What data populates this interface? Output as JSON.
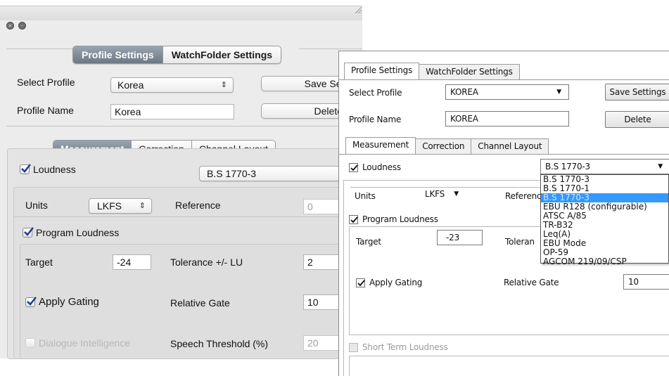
{
  "mac_window": {
    "tabs": [
      "Profile Settings",
      "WatchFolder Settings"
    ],
    "select_profile_label": "Select Profile",
    "select_profile_value": "Korea",
    "save_button": "Save Setting",
    "profile_name_label": "Profile Name",
    "profile_name_value": "Korea",
    "delete_button": "Delete",
    "sub_tabs": [
      "Measurement",
      "Correction",
      "Channel Layout"
    ],
    "loudness_label": "Loudness",
    "loudness_standard": "B.S 1770-3",
    "units_label": "Units",
    "units_value": "LKFS",
    "reference_label": "Reference",
    "reference_value": "0",
    "program_loudness_label": "Program Loudness",
    "target_label": "Target",
    "target_value": "-24",
    "tolerance_label": "Tolerance +/- LU",
    "tolerance_value": "2",
    "apply_gating_label": "Apply Gating",
    "relative_gate_label": "Relative Gate",
    "relative_gate_value": "10",
    "dialogue_label": "Dialogue Intelligence",
    "speech_threshold_label": "Speech Threshold (%)",
    "speech_threshold_value": "20"
  },
  "win_window": {
    "tabs": [
      "Profile Settings",
      "WatchFolder Settings"
    ],
    "select_profile_label": "Select Profile",
    "select_profile_value": "KOREA",
    "save_button": "Save Settings",
    "profile_name_label": "Profile Name",
    "profile_name_value": "KOREA",
    "delete_button": "Delete",
    "sub_tabs": [
      "Measurement",
      "Correction",
      "Channel Layout"
    ],
    "loudness_label": "Loudness",
    "loudness_standard": "B.S 1770-3",
    "units_label": "Units",
    "units_value": "LKFS",
    "reference_label": "Reference",
    "program_loudness_label": "Program Loudness",
    "target_label": "Target",
    "target_value": "-23",
    "tolerance_label": "Toleran",
    "apply_gating_label": "Apply Gating",
    "relative_gate_label": "Relative Gate",
    "relative_gate_value": "10",
    "short_term_label": "Short Term Loudness",
    "dropdown_options": [
      "B.S 1770-3",
      "B.S 1770-1",
      "B.S 1770-3",
      "EBU R128 (configurable)",
      "ATSC A/85",
      "TR-B32",
      "Leq(A)",
      "EBU Mode",
      "OP-59",
      "AGCOM 219/09/CSP"
    ]
  },
  "colors": {
    "mac_tab_active": "#7a8490",
    "win_highlight": "#3399ff"
  }
}
